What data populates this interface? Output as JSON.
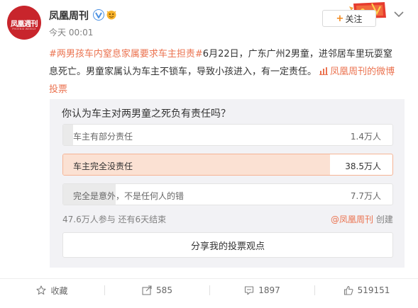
{
  "account": {
    "avatar_text": "凤凰週刊",
    "avatar_sub": "PHOENIX WEEKLY",
    "name": "凤凰周刊",
    "post_time": "今天 00:01",
    "follow_label": "关注"
  },
  "post": {
    "topic": "#两男孩车内窒息家属要求车主担责#",
    "text": "6月22日，广东广州2男童，进邻居车里玩耍窒息死亡。男童家属认为车主不锁车，导致小孩进入，有一定责任。",
    "source_link": "凤凰周刊的微博投票",
    "source_icon": "chart-icon"
  },
  "vote": {
    "question": "你认为车主对两男童之死负有责任吗？",
    "options": [
      {
        "label": "车主有部分责任",
        "count": "1.4万人",
        "fraction": 0.03,
        "selected": false
      },
      {
        "label": "车主完全没责任",
        "count": "38.5万人",
        "fraction": 0.81,
        "selected": true
      },
      {
        "label": "完全是意外，不是任何人的错",
        "count": "7.7万人",
        "fraction": 0.16,
        "selected": false
      }
    ],
    "meta": "47.6万人参与 还有6天结束",
    "creator_prefix": "@",
    "creator_name": "凤凰周刊",
    "creator_suffix": " 创建",
    "share_label": "分享我的投票观点"
  },
  "actions": {
    "favorite": "收藏",
    "repost": "585",
    "comment": "1897",
    "like": "519151"
  },
  "colors": {
    "link": "#eb7350",
    "selected_fill": "#fbe1d3",
    "selected_border": "#f6b495",
    "bar_fill": "#eaeaea",
    "avatar_red": "#c8252c",
    "follow_plus": "#f18618"
  }
}
